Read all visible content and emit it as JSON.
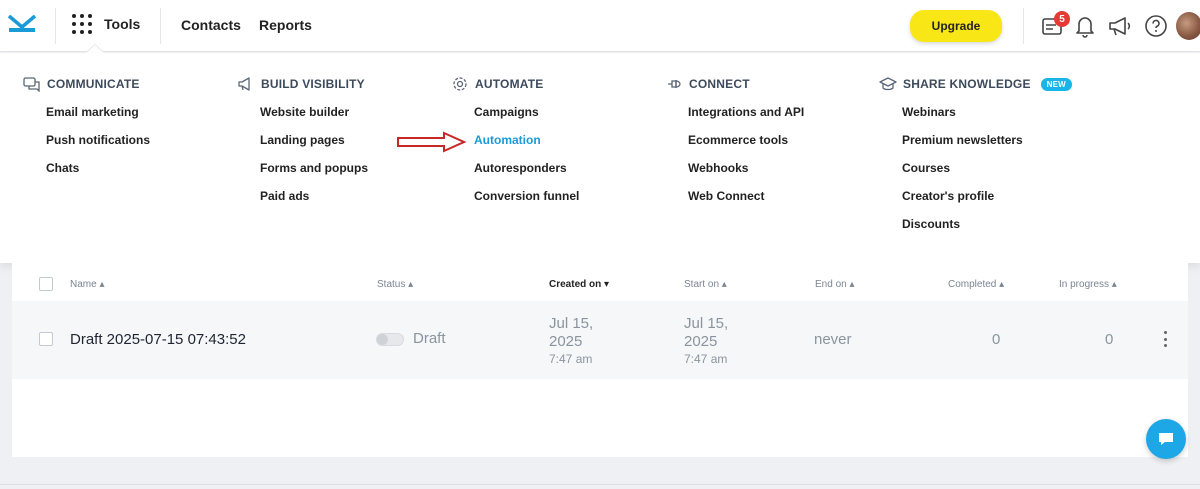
{
  "header": {
    "tools_label": "Tools",
    "nav": [
      "Contacts",
      "Reports"
    ],
    "upgrade_label": "Upgrade",
    "notifications_count": "5",
    "icons": [
      "envelope-logo-icon",
      "apps-grid-icon",
      "messages-icon",
      "bell-icon",
      "megaphone-icon",
      "help-icon",
      "avatar"
    ]
  },
  "menu": {
    "columns": [
      {
        "title": "COMMUNICATE",
        "icon": "chat-bubbles-icon",
        "items": [
          "Email marketing",
          "Push notifications",
          "Chats"
        ]
      },
      {
        "title": "BUILD VISIBILITY",
        "icon": "megaphone-icon",
        "items": [
          "Website builder",
          "Landing pages",
          "Forms and popups",
          "Paid ads"
        ]
      },
      {
        "title": "AUTOMATE",
        "icon": "gear-icon",
        "items": [
          "Campaigns",
          "Automation",
          "Autoresponders",
          "Conversion funnel"
        ]
      },
      {
        "title": "CONNECT",
        "icon": "plug-icon",
        "items": [
          "Integrations and API",
          "Ecommerce tools",
          "Webhooks",
          "Web Connect"
        ]
      },
      {
        "title": "SHARE KNOWLEDGE",
        "icon": "graduation-cap-icon",
        "badge": "NEW",
        "items": [
          "Webinars",
          "Premium newsletters",
          "Courses",
          "Creator's profile",
          "Discounts"
        ]
      }
    ],
    "active_item": "Automation"
  },
  "table": {
    "headers": [
      "Name",
      "Status",
      "Created on",
      "Start on",
      "End on",
      "Completed",
      "In progress"
    ],
    "rows": [
      {
        "name": "Draft 2025-07-15 07:43:52",
        "status": "Draft",
        "created_date": "Jul 15,",
        "created_year": "2025",
        "created_time": "7:47 am",
        "start_date": "Jul 15,",
        "start_year": "2025",
        "start_time": "7:47 am",
        "end_on": "never",
        "completed": "0",
        "in_progress": "0"
      }
    ]
  },
  "colors": {
    "accent": "#1a9bd7",
    "upgrade": "#f9e617",
    "badge": "#e53935",
    "arrow": "#c62828"
  }
}
